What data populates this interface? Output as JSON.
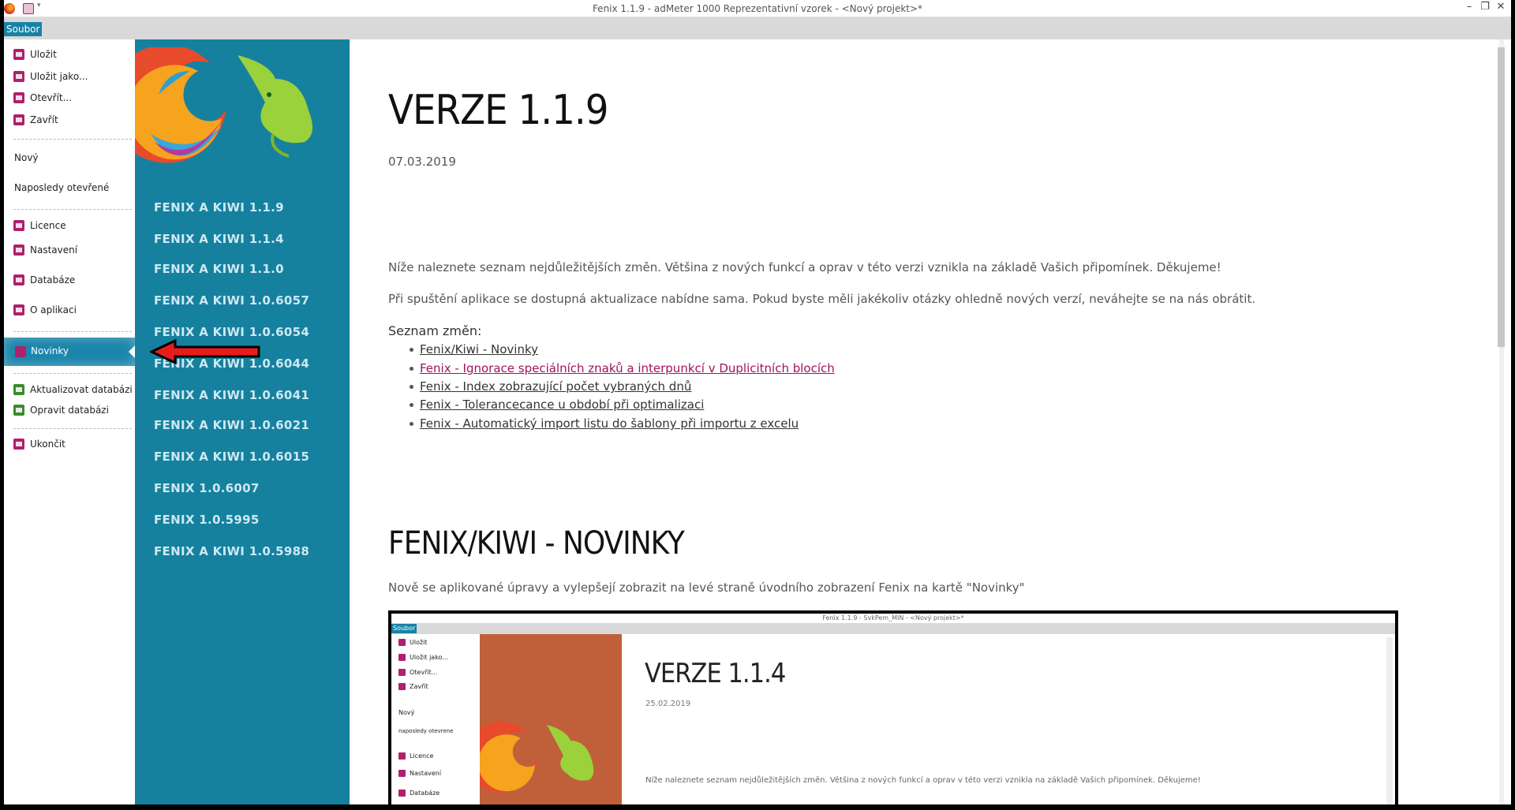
{
  "window": {
    "title": "Fenix 1.1.9 - adMeter 1000 Reprezentativní vzorek - <Nový projekt>*",
    "menu": "Soubor",
    "controls": [
      "minimize-icon",
      "restore-icon",
      "close-icon"
    ]
  },
  "left_menu": {
    "items": [
      {
        "label": "Uložit",
        "icon": "save-icon",
        "color": "#b0206d"
      },
      {
        "label": "Uložit jako...",
        "icon": "save-as-icon",
        "color": "#b0206d"
      },
      {
        "label": "Otevřít...",
        "icon": "open-icon",
        "color": "#b0206d"
      },
      {
        "label": "Zavřít",
        "icon": "close-file-icon",
        "color": "#b0206d"
      },
      {
        "label": "Nový"
      },
      {
        "label": "Naposledy otevřené"
      },
      {
        "label": "Licence",
        "icon": "license-icon",
        "color": "#b0206d"
      },
      {
        "label": "Nastavení",
        "icon": "settings-icon",
        "color": "#b0206d"
      },
      {
        "label": "Databáze",
        "icon": "database-icon",
        "color": "#b0206d"
      },
      {
        "label": "O aplikaci",
        "icon": "info-icon",
        "color": "#b0206d"
      },
      {
        "label": "Novinky",
        "icon": "news-icon",
        "color": "#b0206d",
        "selected": true
      },
      {
        "label": "Aktualizovat databázi",
        "icon": "update-db-icon",
        "color": "#3c8a2e"
      },
      {
        "label": "Opravit databázi",
        "icon": "repair-db-icon",
        "color": "#3c8a2e"
      },
      {
        "label": "Ukončit",
        "icon": "exit-icon",
        "color": "#b0206d"
      }
    ]
  },
  "versions": [
    "FENIX A KIWI 1.1.9",
    "FENIX A KIWI 1.1.4",
    "FENIX A KIWI 1.1.0",
    "FENIX A KIWI 1.0.6057",
    "FENIX A KIWI 1.0.6054",
    "FENIX A KIWI 1.0.6044",
    "FENIX A KIWI 1.0.6041",
    "FENIX A KIWI 1.0.6021",
    "FENIX A KIWI 1.0.6015",
    "FENIX 1.0.6007",
    "FENIX 1.0.5995",
    "FENIX A KIWI 1.0.5988"
  ],
  "main": {
    "heading": "VERZE 1.1.9",
    "date": "07.03.2019",
    "intro1": "Níže naleznete seznam nejdůležitějších změn. Většina z nových funkcí a oprav v této verzi vznikla na základě Vašich připomínek. Děkujeme!",
    "intro2": "Při spuštění aplikace se dostupná aktualizace nabídne sama. Pokud byste měli jakékoliv otázky ohledně nových verzí, neváhejte se na nás obrátit.",
    "list_title": "Seznam změn:",
    "changes": [
      "Fenix/Kiwi - Novinky",
      "Fenix - Ignorace speciálních znaků a interpunkcí v Duplicitních blocích",
      "Fenix - Index zobrazující počet vybraných dnů",
      "Fenix - Tolerancecance u období při optimalizaci",
      "Fenix - Automatický import listu do šablony při importu z excelu"
    ],
    "section_heading": "FENIX/KIWI - NOVINKY",
    "section_text": "Nově se aplikované úpravy a vylepšejí zobrazit na levé straně úvodního zobrazení Fenix na kartě \"Novinky\""
  },
  "embedded": {
    "title": "Fenix 1.1.9 - SvkPem_MIN - <Nový projekt>*",
    "menu": "Soubor",
    "items": [
      "Uložit",
      "Uložit jako...",
      "Otevřít...",
      "Zavřít",
      "Nový",
      "naposledy otevrene",
      "Licence",
      "Nastavení",
      "Databáze"
    ],
    "heading": "VERZE 1.1.4",
    "date": "25.02.2019",
    "text": "Níže naleznete seznam nejdůležitějších změn. Většina z nových funkcí a oprav v této verzi vznikla na základě Vašich připomínek. Děkujeme!"
  }
}
